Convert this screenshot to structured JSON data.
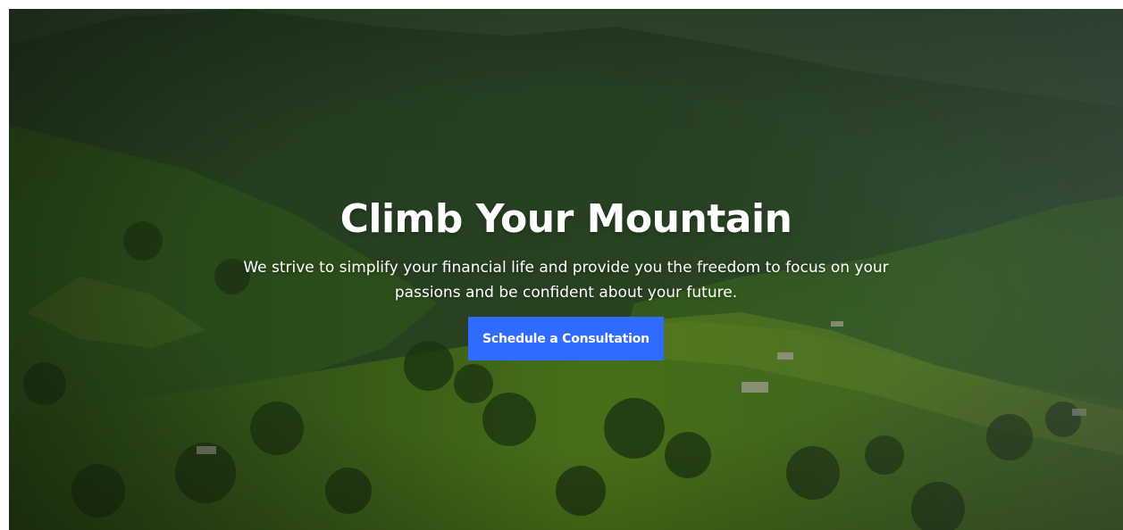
{
  "hero": {
    "title": "Climb Your Mountain",
    "subtitle": "We strive to simplify your financial life and provide you the freedom to focus on your passions and be confident about your future.",
    "cta_label": "Schedule a Consultation",
    "background_image": "green-mountain-valley-landscape"
  },
  "colors": {
    "cta_background": "#2f6bff",
    "cta_text": "#ffffff",
    "heading_text": "#ffffff",
    "page_background": "#ffffff"
  }
}
